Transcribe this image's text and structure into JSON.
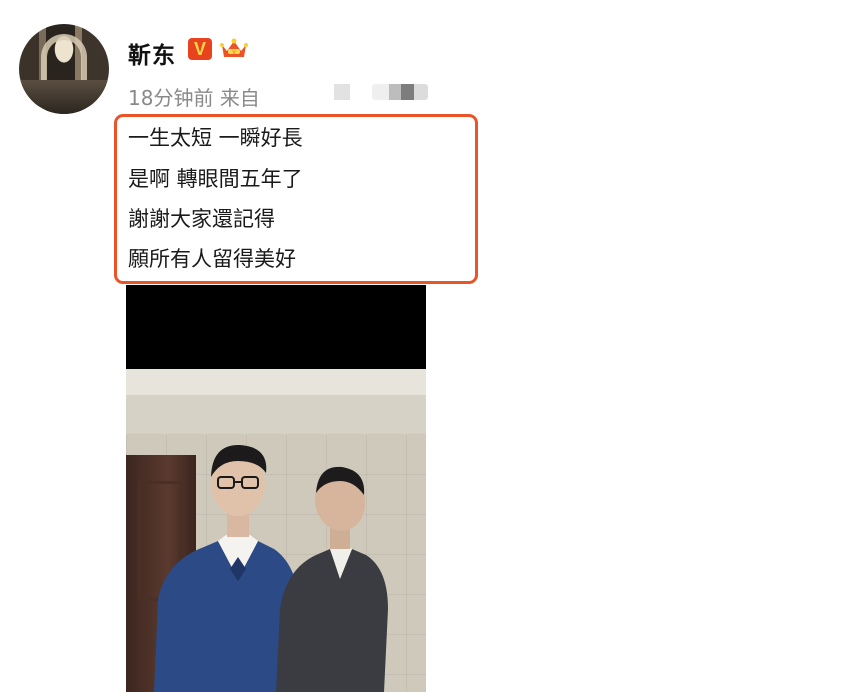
{
  "post": {
    "author": "靳东",
    "verified_badge": "V",
    "time": "18分钟前",
    "source_label": "来自",
    "lines": [
      "一生太短 一瞬好長",
      "是啊 轉眼間五年了",
      "謝謝大家還記得",
      "願所有人留得美好"
    ]
  },
  "icons": {
    "avatar": "profile-avatar",
    "crown": "crown-icon"
  },
  "colors": {
    "highlight_border": "#ea5428",
    "badge_red": "#e8421f",
    "badge_gold": "#ffd84a",
    "meta_gray": "#8a8a8a"
  }
}
